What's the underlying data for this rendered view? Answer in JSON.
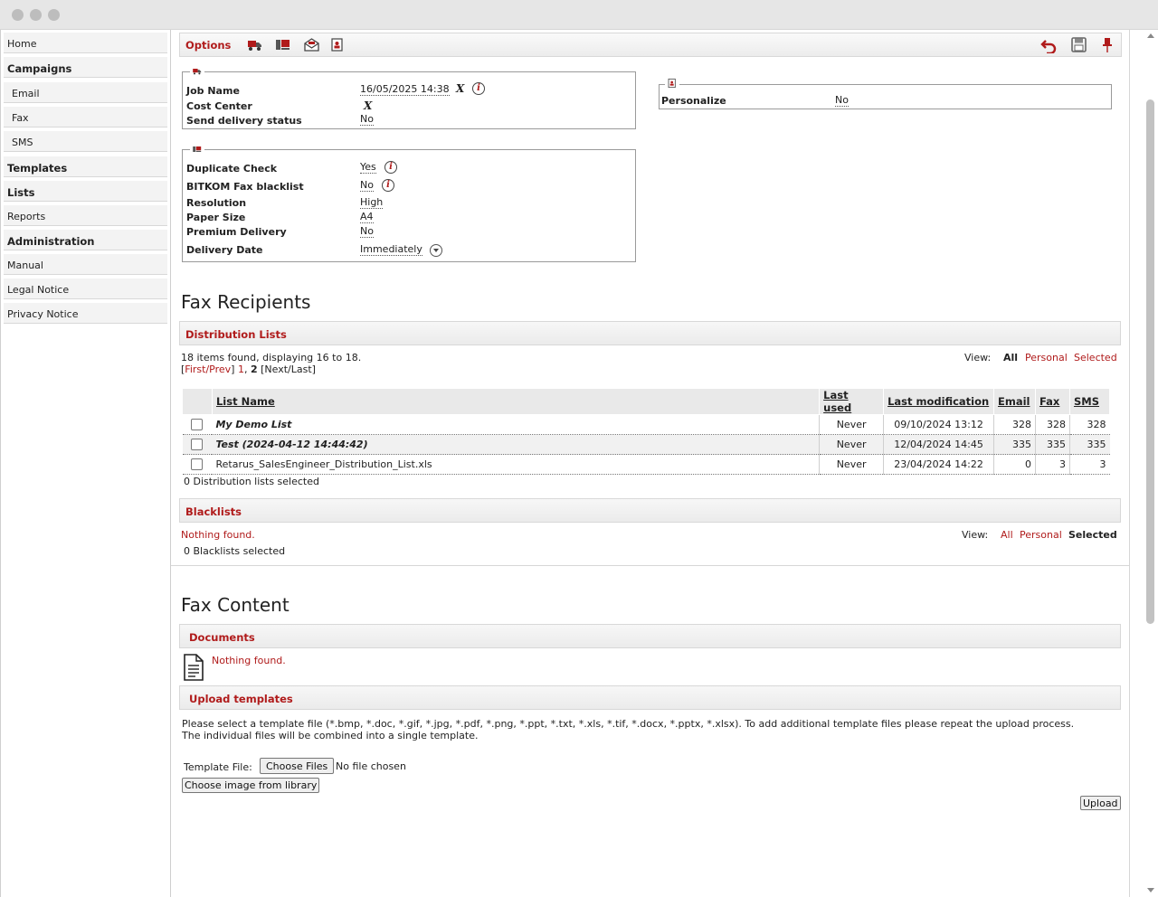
{
  "sidebar": {
    "items": [
      {
        "label": "Home"
      },
      {
        "label": "Campaigns"
      },
      {
        "label": "Email"
      },
      {
        "label": "Fax"
      },
      {
        "label": "SMS"
      },
      {
        "label": "Templates"
      },
      {
        "label": "Lists"
      },
      {
        "label": "Reports"
      },
      {
        "label": "Administration"
      },
      {
        "label": "Manual"
      },
      {
        "label": "Legal Notice"
      },
      {
        "label": "Privacy Notice"
      }
    ]
  },
  "toolbar": {
    "options_label": "Options",
    "icons": [
      "truck-icon",
      "fax-machine-icon",
      "mail-open-icon",
      "contact-book-icon",
      "undo-icon",
      "save-icon",
      "pin-icon"
    ]
  },
  "job_settings": {
    "job_name_label": "Job Name",
    "job_name_value": "16/05/2025 14:38",
    "cost_center_label": "Cost Center",
    "send_delivery_status_label": "Send delivery status",
    "send_delivery_status_value": "No"
  },
  "fax_settings": {
    "duplicate_check_label": "Duplicate Check",
    "duplicate_check_value": "Yes",
    "bitkom_label": "BITKOM Fax blacklist",
    "bitkom_value": "No",
    "resolution_label": "Resolution",
    "resolution_value": "High",
    "paper_size_label": "Paper Size",
    "paper_size_value": "A4",
    "premium_delivery_label": "Premium Delivery",
    "premium_delivery_value": "No",
    "delivery_date_label": "Delivery Date",
    "delivery_date_value": "Immediately"
  },
  "personalize": {
    "label": "Personalize",
    "value": "No"
  },
  "fax_recipients": {
    "title": "Fax Recipients",
    "distribution_lists": {
      "heading": "Distribution Lists",
      "summary": "18 items found, displaying 16 to 18.",
      "pager_first_prev": "First/Prev",
      "pager_page1": "1",
      "pager_page2": "2",
      "pager_next_last": "[Next/Last]",
      "view_label": "View:",
      "view_all": "All",
      "view_personal": "Personal",
      "view_selected": "Selected",
      "columns": [
        "List Name",
        "Last used",
        "Last modification",
        "Email",
        "Fax",
        "SMS"
      ],
      "rows": [
        {
          "name": "My Demo List",
          "last_used": "Never",
          "last_modification": "09/10/2024 13:12",
          "email": "328",
          "fax": "328",
          "sms": "328"
        },
        {
          "name": "Test (2024-04-12 14:44:42)",
          "last_used": "Never",
          "last_modification": "12/04/2024 14:45",
          "email": "335",
          "fax": "335",
          "sms": "335"
        },
        {
          "name": "Retarus_SalesEngineer_Distribution_List.xls",
          "last_used": "Never",
          "last_modification": "23/04/2024 14:22",
          "email": "0",
          "fax": "3",
          "sms": "3"
        }
      ],
      "selected_count": "0 Distribution lists selected"
    },
    "blacklists": {
      "heading": "Blacklists",
      "nothing_found": "Nothing found.",
      "view_label": "View:",
      "view_all": "All",
      "view_personal": "Personal",
      "view_selected": "Selected",
      "selected_count": "0 Blacklists selected"
    }
  },
  "fax_content": {
    "title": "Fax Content",
    "documents_heading": "Documents",
    "documents_nothing_found": "Nothing found.",
    "upload_heading": "Upload templates",
    "upload_instructions_1": "Please select a template file (*.bmp, *.doc, *.gif, *.jpg, *.pdf, *.png, *.ppt, *.txt, *.xls, *.tif, *.docx, *.pptx, *.xlsx). To add additional template files please repeat the upload process.",
    "upload_instructions_2": "The individual files will be combined into a single template.",
    "template_file_label": "Template File:",
    "choose_files_label": "Choose Files",
    "no_file_chosen": "No file chosen",
    "choose_library_label": "Choose image from library",
    "upload_label": "Upload"
  },
  "colors": {
    "accent": "#b01b1b"
  }
}
